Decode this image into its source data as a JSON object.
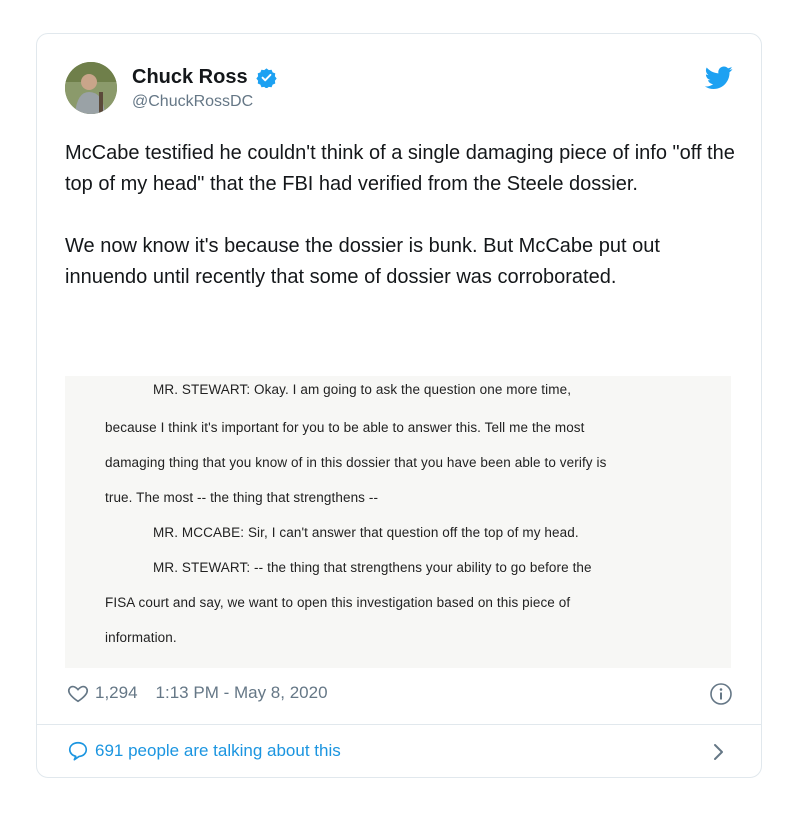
{
  "user": {
    "display_name": "Chuck Ross",
    "handle": "@ChuckRossDC"
  },
  "tweet": {
    "paragraphs": [
      "McCabe testified he couldn't think of a single damaging piece of info \"off the top of my head\" that the FBI had verified from the Steele dossier.",
      "We now know it's because the dossier is bunk. But McCabe put out innuendo until recently that some of dossier was corroborated."
    ]
  },
  "document": {
    "lines": [
      "MR. STEWART:   Okay.   I am going to ask the question one more time,",
      "because I think it's important for you to be able to answer this.   Tell me the most",
      "damaging thing that you know of in this dossier that you have been able to verify is",
      "true.   The most -- the thing that strengthens --",
      "MR. MCCABE:   Sir, I can't answer that question off the top of my head.",
      "MR. STEWART:   -- the thing that strengthens your ability to go before the",
      "FISA court and say, we want to open this investigation based on this piece of",
      "information."
    ]
  },
  "footer": {
    "likes": "1,294",
    "timestamp": "1:13 PM - May 8, 2020",
    "talking": "691 people are talking about this"
  },
  "colors": {
    "accent": "#1da1f2",
    "link": "#1b95e0",
    "muted": "#657786",
    "border": "#e1e8ed"
  },
  "icons": [
    "verified-badge-icon",
    "twitter-bird-icon",
    "heart-icon",
    "info-icon",
    "speech-bubble-icon",
    "chevron-right-icon"
  ]
}
